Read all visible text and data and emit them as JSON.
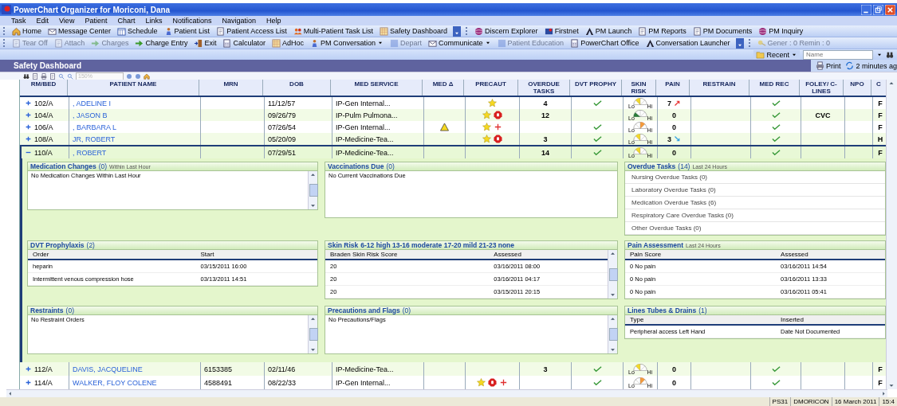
{
  "window": {
    "title": "PowerChart Organizer for Moriconi, Dana"
  },
  "menu": [
    "Task",
    "Edit",
    "View",
    "Patient",
    "Chart",
    "Links",
    "Notifications",
    "Navigation",
    "Help"
  ],
  "toolbar_1": [
    {
      "label": "Home",
      "disabled": false
    },
    {
      "label": "Message Center",
      "disabled": false
    },
    {
      "label": "Schedule",
      "disabled": false
    },
    {
      "label": "Patient List",
      "disabled": false
    },
    {
      "label": "Patient Access List",
      "disabled": false
    },
    {
      "label": "Multi-Patient Task List",
      "disabled": false
    },
    {
      "label": "Safety Dashboard",
      "disabled": false
    },
    {
      "label": "Discern Explorer",
      "disabled": false
    },
    {
      "label": "Firstnet",
      "disabled": false
    },
    {
      "label": "PM Launch",
      "disabled": false
    },
    {
      "label": "PM Reports",
      "disabled": false
    },
    {
      "label": "PM Documents",
      "disabled": false
    },
    {
      "label": "PM Inquiry",
      "disabled": false
    }
  ],
  "toolbar_2": [
    {
      "label": "Tear Off",
      "disabled": true
    },
    {
      "label": "Attach",
      "disabled": true
    },
    {
      "label": "Charges",
      "disabled": true
    },
    {
      "label": "Charge Entry",
      "disabled": false
    },
    {
      "label": "Exit",
      "disabled": false
    },
    {
      "label": "Calculator",
      "disabled": false
    },
    {
      "label": "AdHoc",
      "disabled": false
    },
    {
      "label": "PM Conversation",
      "disabled": false,
      "dropdown": true
    },
    {
      "label": "Depart",
      "disabled": true
    },
    {
      "label": "Communicate",
      "disabled": false,
      "dropdown": true
    },
    {
      "label": "Patient Education",
      "disabled": true
    },
    {
      "label": "PowerChart Office",
      "disabled": false
    },
    {
      "label": "Conversation Launcher",
      "disabled": false
    },
    {
      "label": "Gener : 0  Remin : 0",
      "disabled": true
    }
  ],
  "quick_bar": {
    "recent": "Recent",
    "name_placeholder": "Name"
  },
  "dashboard": {
    "title": "Safety Dashboard",
    "print": "Print",
    "refreshed": "2 minutes ag"
  },
  "view_toolbar": {
    "zoom": "150%"
  },
  "table": {
    "columns": [
      "RM/BED",
      "PATIENT NAME",
      "MRN",
      "DOB",
      "MED SERVICE",
      "MED Δ",
      "PRECAUT",
      "OVERDUE TASKS",
      "DVT PROPHY",
      "SKIN RISK",
      "PAIN",
      "RESTRAIN",
      "MED REC",
      "FOLEY/ C-LINES",
      "NPO",
      "C"
    ],
    "rows": [
      {
        "expanded": false,
        "selected": false,
        "room": "102/A",
        "name": ", ADELINE I",
        "dob": "11/12/57",
        "service": "IP-Gen Internal...",
        "med_alert": false,
        "precautions": [
          {
            "kind": "star"
          }
        ],
        "overdue": "4",
        "dvt": true,
        "skin": {
          "kind": "mild",
          "low": "Lo",
          "high": "Hi"
        },
        "pain": "7",
        "pain_icon": {
          "kind": "up"
        },
        "med_rec": true,
        "column_16": "F"
      },
      {
        "expanded": false,
        "selected": false,
        "room": "104/A",
        "name": ", JASON B",
        "dob": "09/26/79",
        "service": "IP-Pulm Pulmona...",
        "med_alert": false,
        "precautions": [
          {
            "kind": "star"
          },
          {
            "kind": "stop"
          }
        ],
        "overdue": "12",
        "dvt": false,
        "skin": {
          "kind": "none",
          "low": "Lo",
          "high": "Hi"
        },
        "pain": "0",
        "med_rec": true,
        "foley": "CVC",
        "column_16": "F"
      },
      {
        "expanded": false,
        "selected": false,
        "room": "106/A",
        "name": ", BARBARA L",
        "dob": "07/26/54",
        "service": "IP-Gen Internal...",
        "med_alert": true,
        "precautions": [
          {
            "kind": "star"
          },
          {
            "kind": "plus"
          }
        ],
        "dvt": true,
        "skin": {
          "kind": "moderate",
          "low": "Lo",
          "high": "Hi"
        },
        "pain": "0",
        "med_rec": true,
        "column_16": "F"
      },
      {
        "expanded": false,
        "selected": false,
        "room": "108/A",
        "name": " JR, ROBERT",
        "dob": "05/20/09",
        "service": "IP-Medicine-Tea...",
        "med_alert": false,
        "precautions": [
          {
            "kind": "star"
          },
          {
            "kind": "stop"
          }
        ],
        "overdue": "3",
        "dvt": true,
        "skin": {
          "kind": "mild",
          "low": "Lo",
          "high": "Hi"
        },
        "pain": "3",
        "pain_icon": {
          "kind": "down"
        },
        "med_rec": true,
        "column_16": "H"
      },
      {
        "expanded": true,
        "selected": true,
        "room": "110/A",
        "name": ", ROBERT",
        "dob": "07/29/51",
        "service": "IP-Medicine-Tea...",
        "med_alert": false,
        "overdue": "14",
        "dvt": true,
        "skin": {
          "kind": "mild",
          "low": "Lo",
          "high": "Hi"
        },
        "pain": "0",
        "med_rec": true,
        "column_16": "F"
      },
      {
        "expanded": false,
        "selected": false,
        "room": "112/A",
        "name": "DAVIS, JACQUELINE",
        "mrn": "6153385",
        "dob": "02/11/46",
        "service": "IP-Medicine-Tea...",
        "med_alert": false,
        "overdue": "3",
        "dvt": true,
        "skin": {
          "kind": "mild",
          "low": "Lo",
          "high": "Hi"
        },
        "pain": "0",
        "med_rec": true,
        "column_16": "F"
      },
      {
        "expanded": false,
        "selected": false,
        "room": "114/A",
        "name": "WALKER, FLOY COLENE",
        "mrn": "4588491",
        "dob": "08/22/33",
        "service": "IP-Gen Internal...",
        "med_alert": false,
        "precautions": [
          {
            "kind": "star"
          },
          {
            "kind": "stop"
          },
          {
            "kind": "plus"
          }
        ],
        "dvt": true,
        "skin": {
          "kind": "moderate",
          "low": "Lo",
          "high": "Hi"
        },
        "pain": "0",
        "med_rec": true,
        "column_16": "F"
      }
    ]
  },
  "details": {
    "panels": [
      {
        "kind": "message",
        "title": "Medication Changes",
        "count": "(0)",
        "note": "Within Last Hour",
        "text": "No Medication Changes Within Last Hour",
        "scrollable": true
      },
      {
        "kind": "message",
        "title": "Vaccinations Due",
        "count": "(0)",
        "text": "No Current Vaccinations Due",
        "scrollable": false
      },
      {
        "kind": "list",
        "title": "Overdue Tasks",
        "count": "(14)",
        "note": "Last 24 Hours",
        "items": [
          "Nursing Overdue Tasks (0)",
          "Laboratory Overdue Tasks (0)",
          "Medication Overdue Tasks (6)",
          "Respiratory Care Overdue Tasks (0)",
          "Other Overdue Tasks (0)"
        ]
      },
      {
        "kind": "table",
        "title": "DVT Prophylaxis",
        "count": "(2)",
        "columns": [
          "Order",
          "Start"
        ],
        "rows": [
          [
            "heparin",
            "03/15/2011 16:00"
          ],
          [
            "Intermittent venous compression hose",
            "03/13/2011 14:51"
          ]
        ],
        "scrollable": false
      },
      {
        "kind": "table",
        "title": "Skin Risk",
        "legend": "6-12 high  13-16 moderate  17-20 mild  21-23 none",
        "columns": [
          "Braden Skin Risk Score",
          "Assessed"
        ],
        "rows": [
          [
            "20",
            "03/16/2011 08:00"
          ],
          [
            "20",
            "03/16/2011 04:17"
          ],
          [
            "20",
            "03/15/2011 20:15"
          ]
        ],
        "scrollable": true
      },
      {
        "kind": "table",
        "title": "Pain Assessment",
        "note": "Last 24 Hours",
        "columns": [
          "Pain Score",
          "Assessed"
        ],
        "rows": [
          [
            "0 No pain",
            "03/16/2011 14:54"
          ],
          [
            "0 No pain",
            "03/16/2011 13:33"
          ],
          [
            "0 No pain",
            "03/16/2011 05:41"
          ]
        ],
        "scrollable": false
      },
      {
        "kind": "message",
        "title": "Restraints",
        "count": "(0)",
        "text": "No Restraint Orders",
        "scrollable": true
      },
      {
        "kind": "message",
        "title": "Precautions and Flags",
        "count": "(0)",
        "text": "No Precautions/Flags",
        "scrollable": true
      },
      {
        "kind": "table",
        "title": "Lines Tubes & Drains",
        "count": "(1)",
        "columns": [
          "Type",
          "Inserted"
        ],
        "rows": [
          [
            "Peripheral access Left Hand",
            "Date Not Documented"
          ]
        ],
        "scrollable": false
      }
    ]
  },
  "status_bar": [
    "PS31",
    "DMORICON",
    "16 March 2011",
    "15:4"
  ]
}
